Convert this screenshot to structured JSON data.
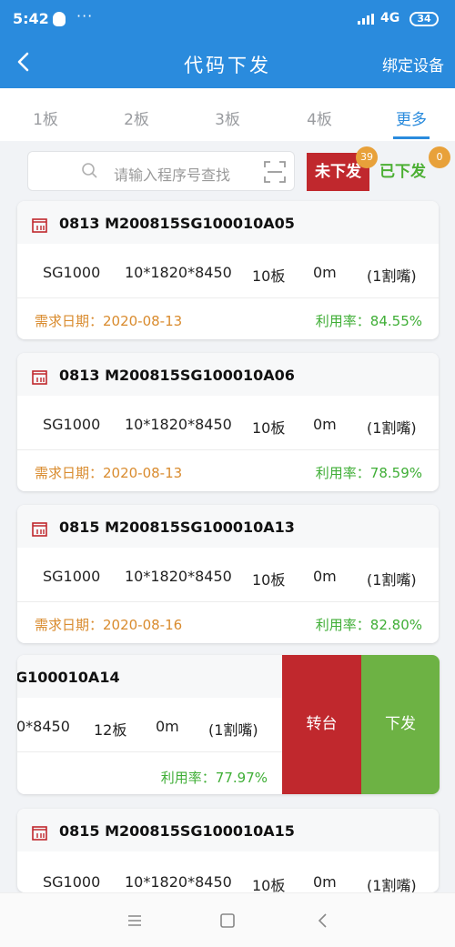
{
  "status_bar": {
    "time": "5:42",
    "dots": "···",
    "network": "4G",
    "battery": "34"
  },
  "header": {
    "title": "代码下发",
    "bind_label": "绑定设备"
  },
  "tabs": [
    "1板",
    "2板",
    "3板",
    "4板",
    "更多"
  ],
  "search": {
    "placeholder": "请输入程序号查找"
  },
  "filters": {
    "pending_label": "未下发",
    "pending_count": "39",
    "sent_label": "已下发",
    "sent_count": "0"
  },
  "cards": [
    {
      "code": "0813 M200815SG100010A05",
      "model": "SG1000",
      "size": "10*1820*8450",
      "boards": "10板",
      "length": "0m",
      "cut": "(1割嘴)",
      "date": "需求日期：2020-08-13",
      "rate": "利用率：84.55%"
    },
    {
      "code": "0813 M200815SG100010A06",
      "model": "SG1000",
      "size": "10*1820*8450",
      "boards": "10板",
      "length": "0m",
      "cut": "(1割嘴)",
      "date": "需求日期：2020-08-13",
      "rate": "利用率：78.59%"
    },
    {
      "code": "0815 M200815SG100010A13",
      "model": "SG1000",
      "size": "10*1820*8450",
      "boards": "10板",
      "length": "0m",
      "cut": "(1割嘴)",
      "date": "需求日期：2020-08-16",
      "rate": "利用率：82.80%"
    }
  ],
  "swiped_card": {
    "code": "G100010A14",
    "size": "0*8450",
    "boards": "12板",
    "length": "0m",
    "cut": "(1割嘴)",
    "rate": "利用率：77.97%",
    "transfer_label": "转台",
    "send_label": "下发"
  },
  "last_card": {
    "code": "0815 M200815SG100010A15",
    "model": "SG1000",
    "size": "10*1820*8450",
    "boards": "10板",
    "length": "0m",
    "cut": "(1割嘴)"
  },
  "colors": {
    "primary": "#2a8bdd",
    "danger": "#c0282d",
    "success": "#6db244",
    "date": "#d98b2e"
  }
}
